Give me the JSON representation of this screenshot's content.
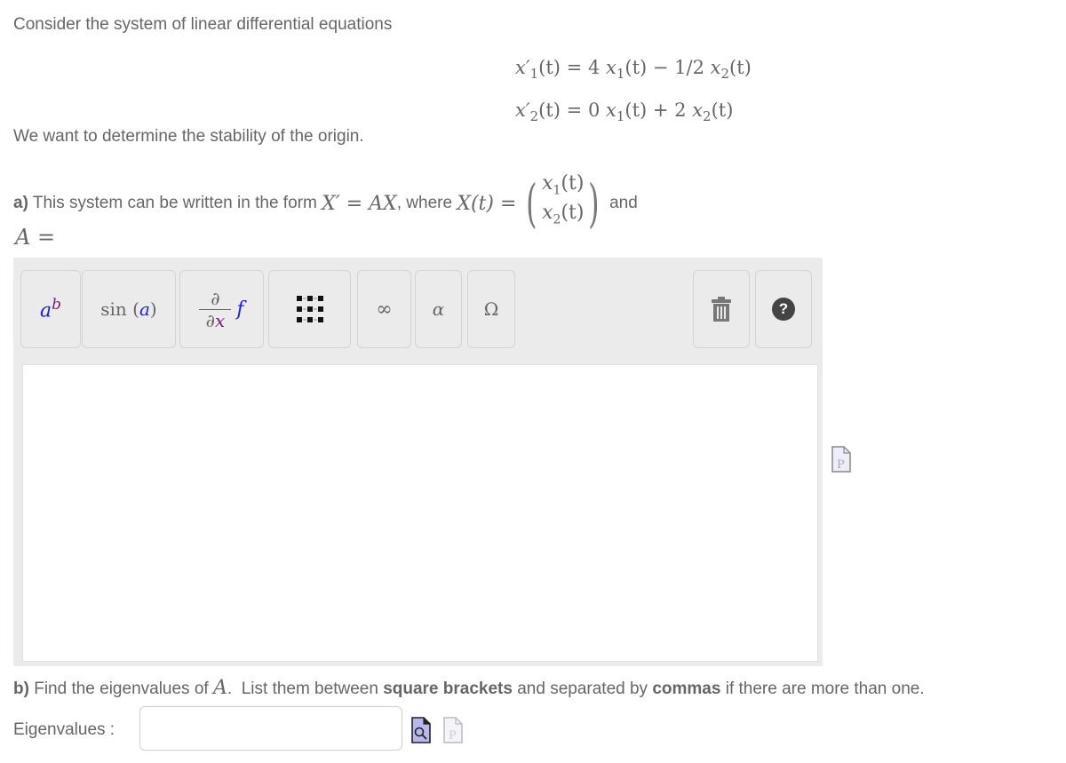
{
  "intro": "Consider the system of linear differential equations",
  "equations": [
    {
      "lhs_var": "x",
      "lhs_sub": "1",
      "rest": "(t) = 4 ",
      "t1_var": "x",
      "t1_sub": "1",
      "mid": "(t) − 1/2 ",
      "t2_var": "x",
      "t2_sub": "2",
      "end": "(t)"
    },
    {
      "lhs_var": "x",
      "lhs_sub": "2",
      "rest": "(t) = 0 ",
      "t1_var": "x",
      "t1_sub": "1",
      "mid": "(t) + 2 ",
      "t2_var": "x",
      "t2_sub": "2",
      "end": "(t)"
    }
  ],
  "stability": "We want to determine the stability of the origin.",
  "part_a": {
    "label": "a)",
    "text1": " This system can be written in the form ",
    "form": "X′ = AX",
    "text2": ", where ",
    "x_def": "X(t) =",
    "vec_top": "x",
    "vec_top_sub": "1",
    "vec_bottom": "x",
    "vec_bottom_sub": "2",
    "vec_arg": "(t)",
    "text3": "and",
    "a_eq": "A ="
  },
  "toolbar": {
    "buttons": [
      {
        "name": "superscript-button",
        "base": "a",
        "sup": "b"
      },
      {
        "name": "function-button",
        "fn": "sin",
        "arg": "a"
      },
      {
        "name": "derivative-button",
        "num": "∂",
        "den_d": "∂",
        "den_x": "x",
        "f": "f"
      },
      {
        "name": "matrix-button"
      },
      {
        "name": "infinity-button",
        "label": "∞"
      },
      {
        "name": "greek-lower-button",
        "label": "α"
      },
      {
        "name": "greek-upper-button",
        "label": "Ω"
      },
      {
        "name": "trash-button"
      },
      {
        "name": "help-button",
        "label": "?"
      }
    ]
  },
  "editor": {
    "value": ""
  },
  "part_b": {
    "label": "b)",
    "text1": " Find the eigenvalues of ",
    "var": "A",
    "text2": ".  List them between ",
    "bold1": "square brackets",
    "text3": " and separated by ",
    "bold2": "commas",
    "text4": " if there are more than one."
  },
  "eigenvalues": {
    "label": "Eigenvalues :",
    "value": "",
    "placeholder": ""
  },
  "colors": {
    "text": "#666666",
    "editor_bg": "#ebebeb",
    "accent_blue": "#1a1aff",
    "accent_purple": "#7a1a7a"
  }
}
